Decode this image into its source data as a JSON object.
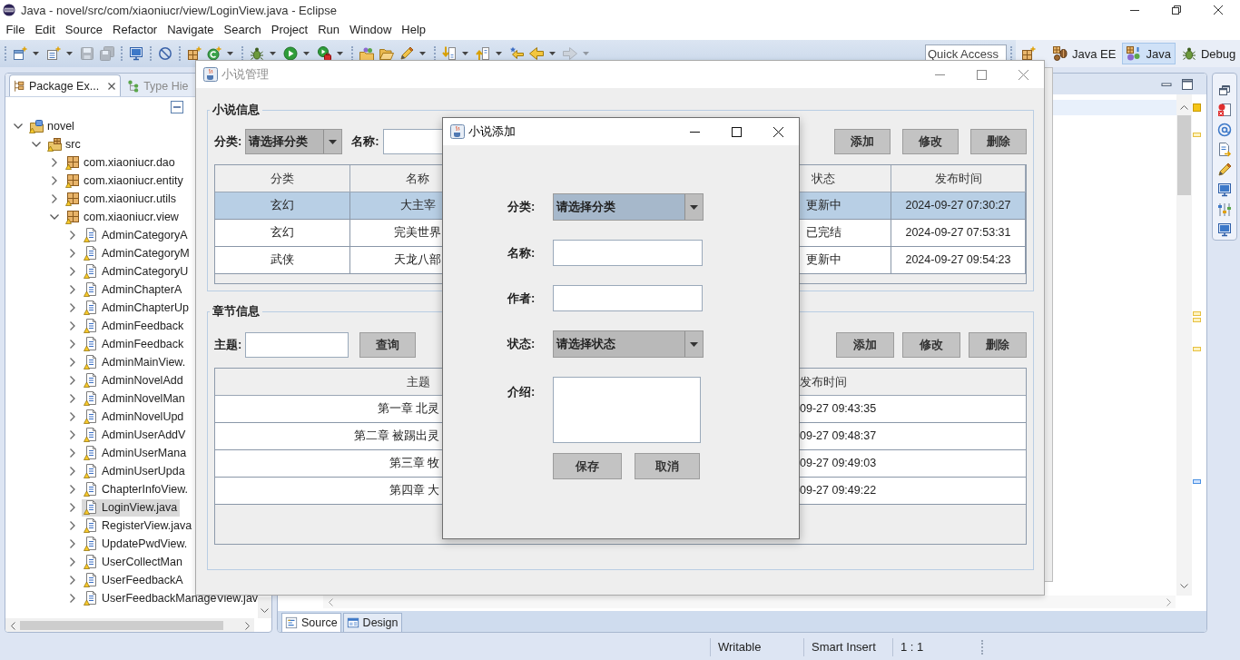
{
  "ide": {
    "title": "Java - novel/src/com/xiaoniucr/view/LoginView.java - Eclipse",
    "menu": [
      "File",
      "Edit",
      "Source",
      "Refactor",
      "Navigate",
      "Search",
      "Project",
      "Run",
      "Window",
      "Help"
    ],
    "toolbar": [
      [
        {
          "kind": "new",
          "disabled": false
        },
        {
          "kind": "caret",
          "disabled": false
        },
        {
          "kind": "newfile",
          "disabled": false
        },
        {
          "kind": "caret",
          "disabled": false
        },
        {
          "kind": "save",
          "disabled": true
        },
        {
          "kind": "saveall",
          "disabled": true
        }
      ],
      [
        {
          "kind": "monitor",
          "disabled": false
        }
      ],
      [
        {
          "kind": "skip",
          "disabled": false
        }
      ],
      [
        {
          "kind": "package",
          "disabled": false
        },
        {
          "kind": "circle",
          "disabled": false
        },
        {
          "kind": "caret",
          "disabled": false
        }
      ],
      [
        {
          "kind": "bug",
          "disabled": false
        },
        {
          "kind": "caret",
          "disabled": false
        },
        {
          "kind": "run",
          "disabled": false
        },
        {
          "kind": "caret",
          "disabled": false
        },
        {
          "kind": "tools",
          "disabled": false
        },
        {
          "kind": "caret",
          "disabled": false
        }
      ],
      [
        {
          "kind": "folder",
          "disabled": false
        },
        {
          "kind": "open",
          "disabled": false
        },
        {
          "kind": "pen",
          "disabled": false
        },
        {
          "kind": "caret",
          "disabled": false
        }
      ],
      [
        {
          "kind": "down",
          "disabled": false
        },
        {
          "kind": "caret",
          "disabled": false
        },
        {
          "kind": "up",
          "disabled": false
        },
        {
          "kind": "caret",
          "disabled": false
        },
        {
          "kind": "star",
          "disabled": false
        },
        {
          "kind": "back",
          "disabled": false
        },
        {
          "kind": "caret",
          "disabled": false
        },
        {
          "kind": "forward",
          "disabled": true
        },
        {
          "kind": "caret",
          "disabled": true
        }
      ]
    ],
    "quick_access": {
      "placeholder": "Quick Access"
    },
    "perspectives": [
      {
        "kind": "javaee",
        "label": "Java EE",
        "selected": false
      },
      {
        "kind": "java",
        "label": "Java",
        "selected": true
      },
      {
        "kind": "debug",
        "label": "Debug",
        "selected": false
      }
    ]
  },
  "package_explorer": {
    "tabs": [
      {
        "kind": "packages",
        "label": "Package Ex...",
        "selected": true
      },
      {
        "kind": "hierarchy",
        "label": "Type Hie",
        "selected": false
      }
    ],
    "tree": [
      {
        "label": "novel",
        "kind": "project",
        "expanded": true,
        "selected": false,
        "children": [
          {
            "label": "src",
            "kind": "source",
            "expanded": true,
            "selected": false,
            "children": [
              {
                "label": "com.xiaoniucr.dao",
                "kind": "package",
                "expanded": false,
                "selected": false
              },
              {
                "label": "com.xiaoniucr.entity",
                "kind": "package",
                "expanded": false,
                "selected": false
              },
              {
                "label": "com.xiaoniucr.utils",
                "kind": "package",
                "expanded": false,
                "selected": false
              },
              {
                "label": "com.xiaoniucr.view",
                "kind": "package",
                "expanded": true,
                "selected": false,
                "children": [
                  {
                    "label": "AdminCategoryA",
                    "kind": "file",
                    "expanded": false,
                    "selected": false
                  },
                  {
                    "label": "AdminCategoryM",
                    "kind": "file",
                    "expanded": false,
                    "selected": false
                  },
                  {
                    "label": "AdminCategoryU",
                    "kind": "file",
                    "expanded": false,
                    "selected": false
                  },
                  {
                    "label": "AdminChapterA",
                    "kind": "file",
                    "expanded": false,
                    "selected": false
                  },
                  {
                    "label": "AdminChapterUp",
                    "kind": "file",
                    "expanded": false,
                    "selected": false
                  },
                  {
                    "label": "AdminFeedback",
                    "kind": "file",
                    "expanded": false,
                    "selected": false
                  },
                  {
                    "label": "AdminFeedback",
                    "kind": "file",
                    "expanded": false,
                    "selected": false
                  },
                  {
                    "label": "AdminMainView.",
                    "kind": "file",
                    "expanded": false,
                    "selected": false
                  },
                  {
                    "label": "AdminNovelAdd",
                    "kind": "file",
                    "expanded": false,
                    "selected": false
                  },
                  {
                    "label": "AdminNovelMan",
                    "kind": "file",
                    "expanded": false,
                    "selected": false
                  },
                  {
                    "label": "AdminNovelUpd",
                    "kind": "file",
                    "expanded": false,
                    "selected": false
                  },
                  {
                    "label": "AdminUserAddV",
                    "kind": "file",
                    "expanded": false,
                    "selected": false
                  },
                  {
                    "label": "AdminUserMana",
                    "kind": "file",
                    "expanded": false,
                    "selected": false
                  },
                  {
                    "label": "AdminUserUpda",
                    "kind": "file",
                    "expanded": false,
                    "selected": false
                  },
                  {
                    "label": "ChapterInfoView.",
                    "kind": "file",
                    "expanded": false,
                    "selected": false
                  },
                  {
                    "label": "LoginView.java",
                    "kind": "file",
                    "expanded": false,
                    "selected": true
                  },
                  {
                    "label": "RegisterView.java",
                    "kind": "file",
                    "expanded": false,
                    "selected": false
                  },
                  {
                    "label": "UpdatePwdView.",
                    "kind": "file",
                    "expanded": false,
                    "selected": false
                  },
                  {
                    "label": "UserCollectMan",
                    "kind": "file",
                    "expanded": false,
                    "selected": false
                  },
                  {
                    "label": "UserFeedbackA",
                    "kind": "file",
                    "expanded": false,
                    "selected": false
                  },
                  {
                    "label": "UserFeedbackManageView.jav",
                    "kind": "file",
                    "expanded": false,
                    "selected": false
                  }
                ]
              }
            ]
          }
        ]
      }
    ]
  },
  "editor": {
    "tabs": [
      {
        "kind": "source",
        "label": "Source",
        "selected": true
      },
      {
        "kind": "design",
        "label": "Design",
        "selected": false
      }
    ]
  },
  "status_bar": [
    "Writable",
    "Smart Insert",
    "1 : 1"
  ],
  "novel_window": {
    "title": "小说管理",
    "active": false,
    "novel_info": {
      "title": "小说信息",
      "filters": [
        {
          "kind": "label",
          "text": "分类:"
        },
        {
          "kind": "combo",
          "value": "请选择分类",
          "focused": false
        },
        {
          "kind": "label",
          "text": "名称:"
        },
        {
          "kind": "input"
        }
      ],
      "buttons": [
        "添加",
        "修改",
        "删除"
      ],
      "table": {
        "columns": [
          "分类",
          "名称",
          "状态",
          "发布时间"
        ],
        "rows": [
          {
            "selected": true,
            "cells": [
              "玄幻",
              "大主宰",
              "更新中",
              "2024-09-27 07:30:27"
            ]
          },
          {
            "selected": false,
            "cells": [
              "玄幻",
              "完美世界",
              "已完结",
              "2024-09-27 07:53:31"
            ]
          },
          {
            "selected": false,
            "cells": [
              "武侠",
              "天龙八部",
              "更新中",
              "2024-09-27 09:54:23"
            ]
          }
        ]
      }
    },
    "chapter_info": {
      "title": "章节信息",
      "filters": [
        {
          "kind": "label",
          "text": "主题:"
        },
        {
          "kind": "input"
        },
        {
          "kind": "button",
          "text": "查询"
        }
      ],
      "buttons": [
        "添加",
        "修改",
        "删除"
      ],
      "table": {
        "columns": [
          "主题",
          "发布时间"
        ],
        "rows": [
          {
            "selected": false,
            "cells": [
              "第一章 北灵",
              "09-27 09:43:35"
            ]
          },
          {
            "selected": false,
            "cells": [
              "第二章 被踢出灵",
              "09-27 09:48:37"
            ]
          },
          {
            "selected": false,
            "cells": [
              "第三章 牧",
              "09-27 09:49:03"
            ]
          },
          {
            "selected": false,
            "cells": [
              "第四章 大",
              "09-27 09:49:22"
            ]
          }
        ]
      }
    }
  },
  "add_dialog": {
    "title": "小说添加",
    "active": true,
    "fields": [
      {
        "label": "分类:",
        "kind": "combo",
        "value": "请选择分类",
        "focused": true
      },
      {
        "label": "名称:",
        "kind": "input"
      },
      {
        "label": "作者:",
        "kind": "input"
      },
      {
        "label": "状态:",
        "kind": "combo",
        "value": "请选择状态",
        "focused": false
      },
      {
        "label": "介绍:",
        "kind": "textarea"
      }
    ],
    "buttons": [
      "保存",
      "取消"
    ]
  }
}
